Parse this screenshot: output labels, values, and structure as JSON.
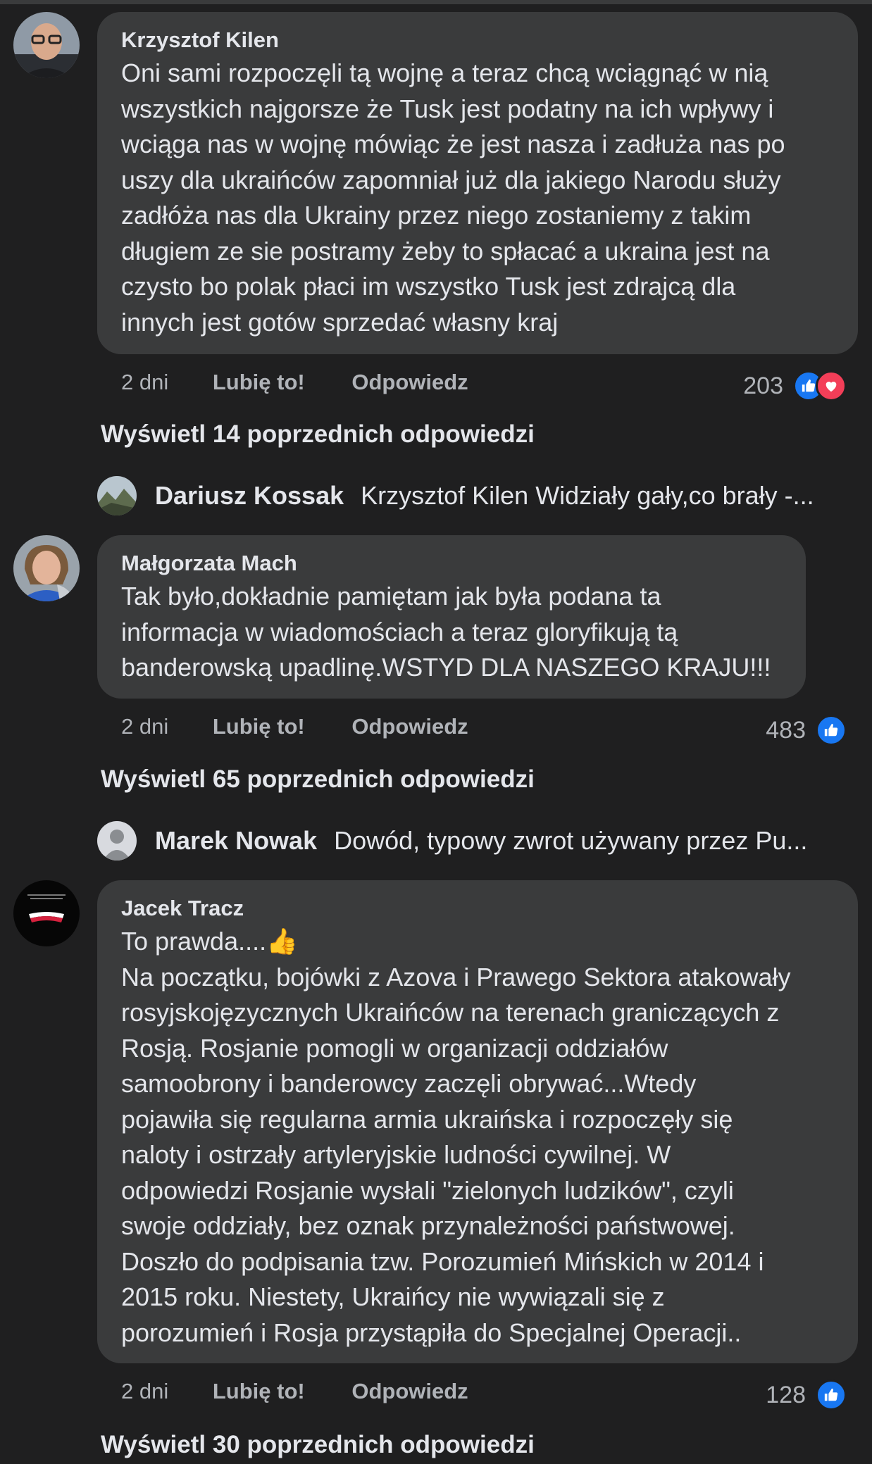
{
  "comments": [
    {
      "author": "Krzysztof Kilen",
      "text": "Oni sami rozpoczęli tą wojnę a teraz chcą wciągnąć w nią\nwszystkich najgorsze że Tusk jest podatny na ich wpływy i\nwciąga nas w wojnę mówiąc że jest nasza i zadłuża nas po\nuszy dla ukraińców zapomniał już dla jakiego Narodu służy\nzadłóża nas dla Ukrainy przez niego zostaniemy z takim\ndługiem ze sie postramy żeby to spłacać a ukraina jest na\nczysto bo polak płaci im wszystko Tusk jest zdrajcą dla\ninnych jest gotów sprzedać własny kraj",
      "time": "2 dni",
      "like_label": "Lubię to!",
      "reply_label": "Odpowiedz",
      "reaction_count": "203",
      "reactions": [
        "like-icon",
        "love-icon"
      ],
      "view_more": "Wyświetl 14 poprzednich odpowiedzi",
      "reply_preview": {
        "author": "Dariusz Kossak",
        "text": "Krzysztof Kilen Widziały gały,co brały -..."
      }
    },
    {
      "author": "Małgorzata Mach",
      "text": "Tak było,dokładnie pamiętam jak była podana ta\ninformacja w wiadomościach a teraz gloryfikują tą\nbanderowską upadlinę.WSTYD DLA NASZEGO KRAJU!!!",
      "time": "2 dni",
      "like_label": "Lubię to!",
      "reply_label": "Odpowiedz",
      "reaction_count": "483",
      "reactions": [
        "like-icon"
      ],
      "view_more": "Wyświetl 65 poprzednich odpowiedzi",
      "reply_preview": {
        "author": "Marek Nowak",
        "text": "Dowód, typowy zwrot używany przez Pu..."
      }
    },
    {
      "author": "Jacek Tracz",
      "text": "To prawda....👍\nNa początku, bojówki z Azova i Prawego Sektora atakowały\nrosyjskojęzycznych Ukraińców na terenach graniczących z\nRosją. Rosjanie pomogli w organizacji oddziałów\nsamoobrony i banderowcy zaczęli obrywać...Wtedy\npojawiła się regularna armia ukraińska i rozpoczęły się\nnaloty i ostrzały artyleryjskie ludności cywilnej. W\nodpowiedzi Rosjanie wysłali \"zielonych ludzików\", czyli\nswoje oddziały, bez oznak przynależności państwowej.\nDoszło do podpisania tzw. Porozumień Mińskich w 2014 i\n2015 roku. Niestety, Ukraińcy nie wywiązali się z\nporozumień i Rosja przystąpiła do Specjalnej Operacji..",
      "time": "2 dni",
      "like_label": "Lubię to!",
      "reply_label": "Odpowiedz",
      "reaction_count": "128",
      "reactions": [
        "like-icon"
      ],
      "view_more": "Wyświetl 30 poprzednich odpowiedzi"
    }
  ],
  "colors": {
    "background": "#1f1f20",
    "bubble": "#3a3b3c",
    "like_blue": "#1877f2",
    "love_red": "#f33e58",
    "muted_text": "#b0b3b8"
  }
}
